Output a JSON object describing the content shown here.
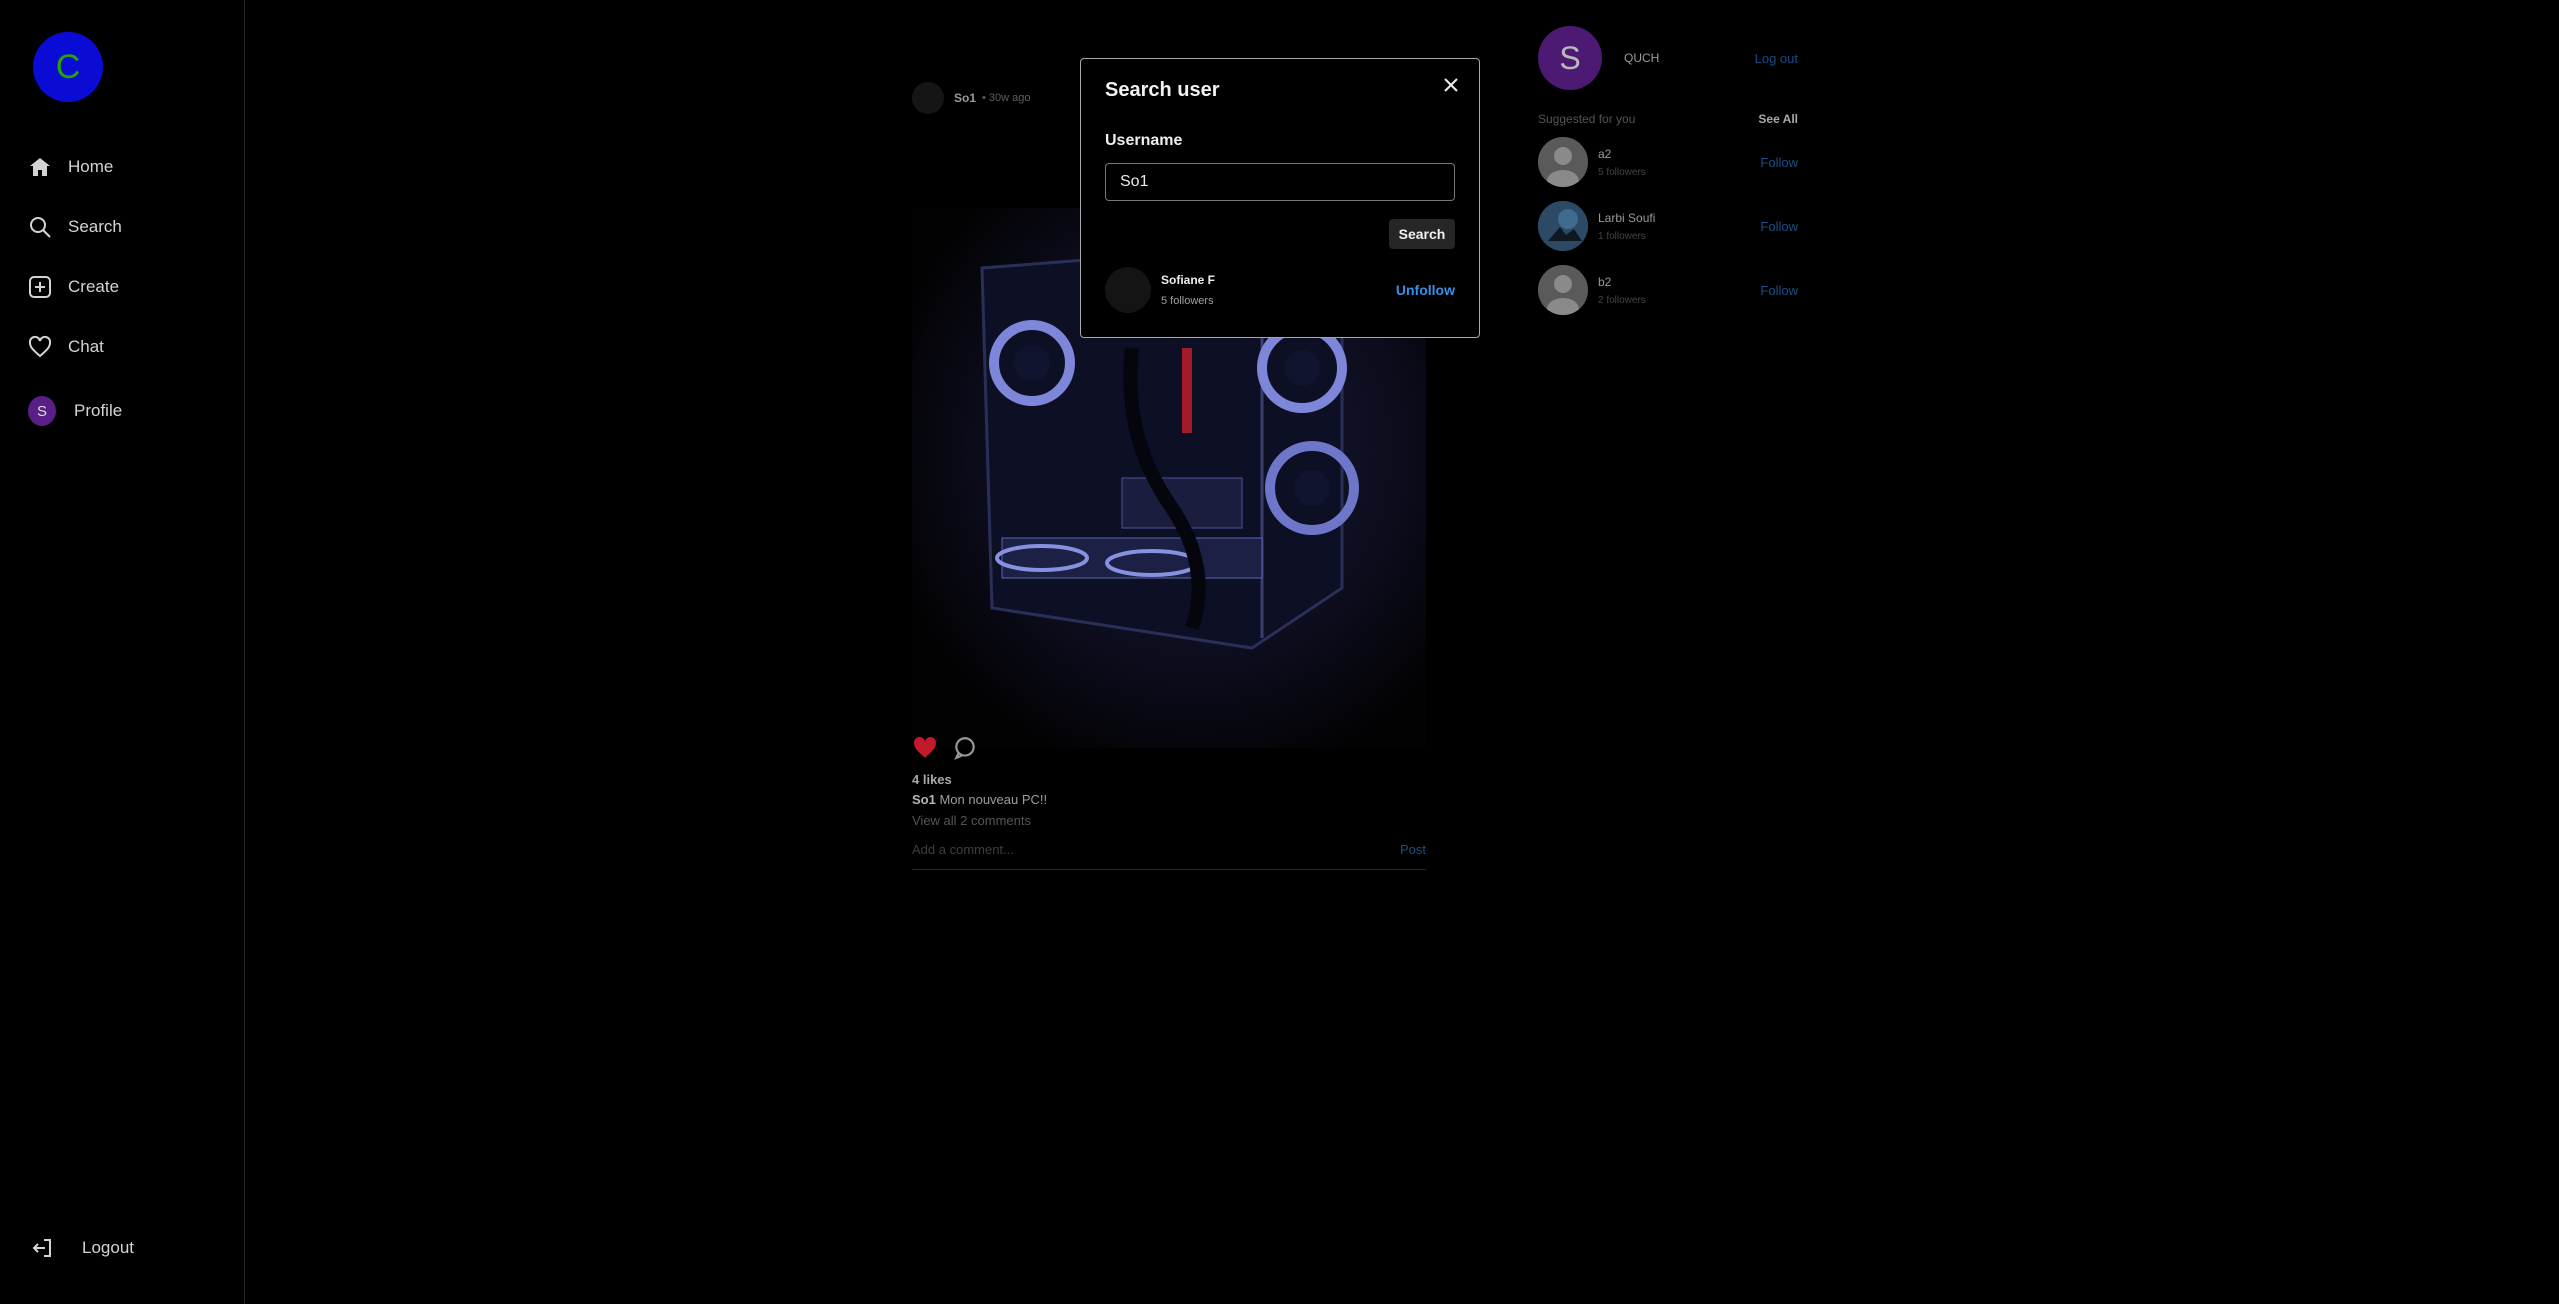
{
  "sidebar": {
    "logo_letter": "C",
    "items": [
      {
        "label": "Home",
        "icon": "home-icon"
      },
      {
        "label": "Search",
        "icon": "search-icon"
      },
      {
        "label": "Create",
        "icon": "plus-square-icon"
      },
      {
        "label": "Chat",
        "icon": "heart-icon"
      },
      {
        "label": "Profile",
        "avatar_letter": "S"
      }
    ],
    "logout_label": "Logout"
  },
  "post": {
    "username": "So1",
    "time": "• 30w ago",
    "likes": "4 likes",
    "caption_user": "So1",
    "caption_text": "Mon nouveau PC!!",
    "view_comments": "View all 2 comments",
    "comment_placeholder": "Add a comment...",
    "post_label": "Post"
  },
  "right_panel": {
    "me_letter": "S",
    "me_name": "QUCH",
    "logout_label": "Log out",
    "suggested_title": "Suggested for you",
    "see_all": "See All",
    "suggestions": [
      {
        "name": "a2",
        "followers": "5 followers",
        "action": "Follow"
      },
      {
        "name": "Larbi Soufi",
        "followers": "1 followers",
        "action": "Follow"
      },
      {
        "name": "b2",
        "followers": "2 followers",
        "action": "Follow"
      }
    ]
  },
  "modal": {
    "title": "Search user",
    "label": "Username",
    "input_value": "So1",
    "search_button": "Search",
    "result": {
      "name": "Sofiane F",
      "followers": "5 followers",
      "action": "Unfollow"
    }
  },
  "colors": {
    "accent_link": "#3c8fe6",
    "like_red": "#c21a2a",
    "logo_bg": "#0b0bd6",
    "logo_fg": "#22a600"
  }
}
